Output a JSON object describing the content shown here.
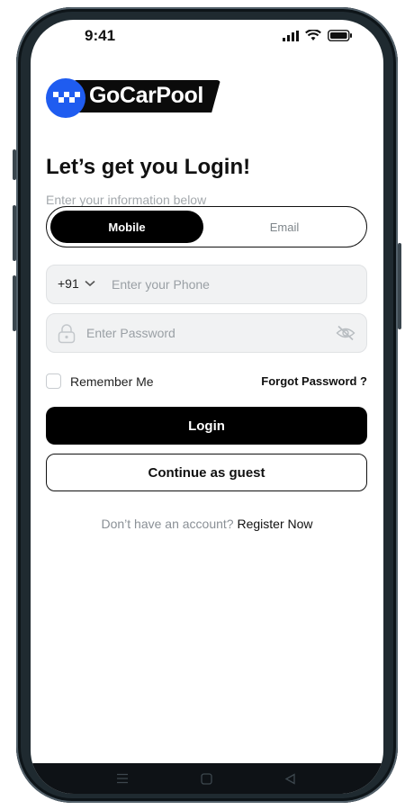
{
  "status_bar": {
    "time": "9:41",
    "icons": [
      "signal-icon",
      "wifi-icon",
      "battery-icon"
    ]
  },
  "brand": {
    "name": "GoCarPool",
    "colors": {
      "circle": "#1f5cf0",
      "banner": "#0b0b0b"
    }
  },
  "login": {
    "title": "Let’s get you Login!",
    "subtitle": "Enter your information below",
    "tabs": [
      {
        "label": "Mobile",
        "active": true
      },
      {
        "label": "Email",
        "active": false
      }
    ],
    "phone": {
      "country_code": "+91",
      "placeholder": "Enter your Phone",
      "value": ""
    },
    "password": {
      "placeholder": "Enter Password",
      "value": ""
    },
    "remember_label": "Remember Me",
    "remember_checked": false,
    "forgot_label": "Forgot Password ?",
    "login_button": "Login",
    "guest_button": "Continue as guest",
    "register_question": "Don’t have an account?",
    "register_link": "Register Now"
  },
  "nav_bar": {
    "icons": [
      "menu-icon",
      "home-square-icon",
      "back-triangle-icon"
    ]
  }
}
